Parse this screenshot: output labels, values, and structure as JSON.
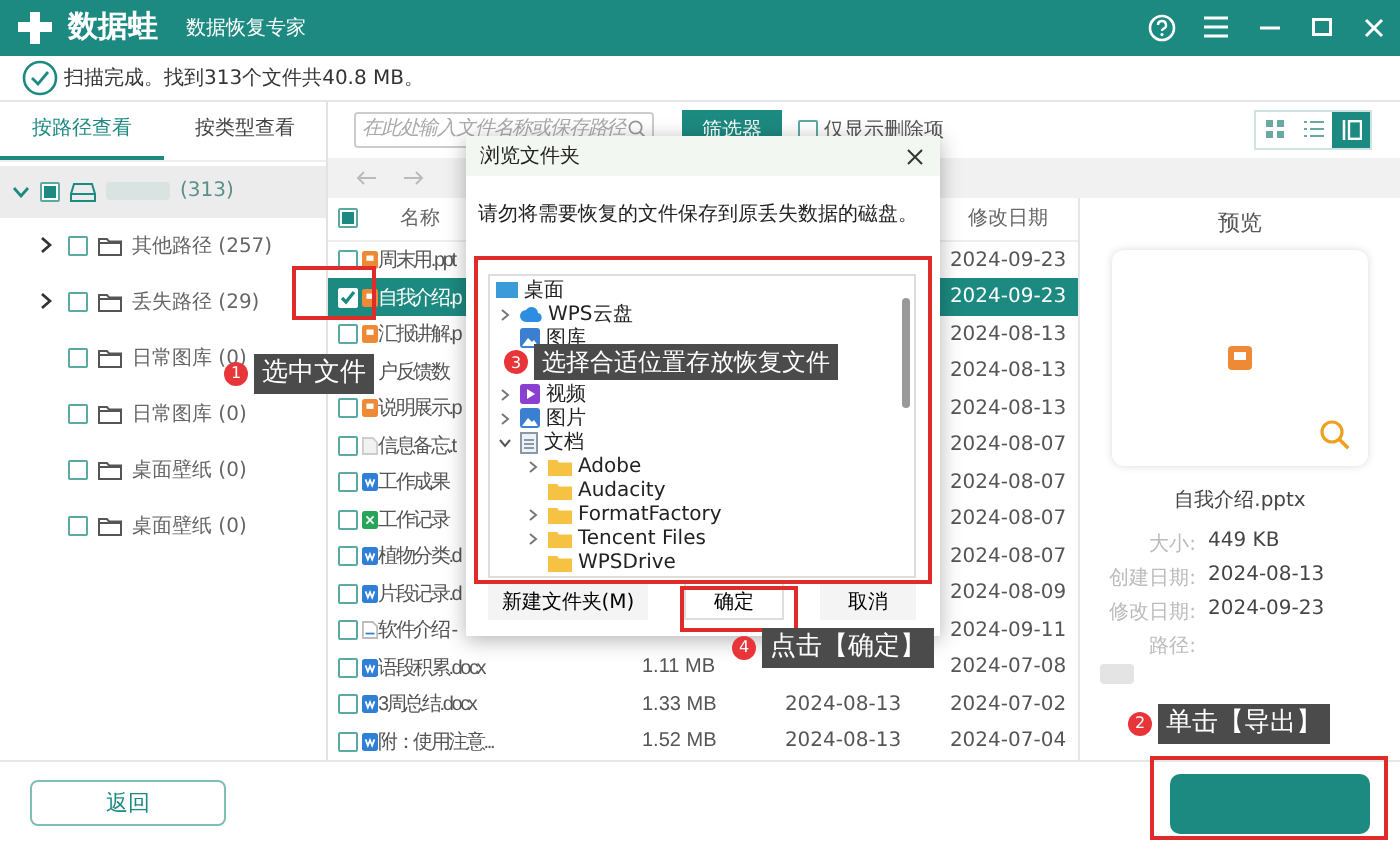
{
  "app": {
    "name": "数据蛙",
    "subtitle": "数据恢复专家"
  },
  "status": "扫描完成。找到313个文件共40.8 MB。",
  "view_tabs": [
    {
      "label": "按路径查看",
      "selected": true
    },
    {
      "label": "按类型查看",
      "selected": false
    }
  ],
  "tree": [
    {
      "label": "(313)",
      "selected": true,
      "checked": false,
      "partial": true,
      "expanded": true,
      "children": [
        {
          "label": "其他路径 (257)",
          "selected": false,
          "checked": false,
          "partial": false,
          "has_children": true,
          "expanded": false
        },
        {
          "label": "丢失路径 (29)",
          "selected": false,
          "checked": false,
          "partial": false,
          "has_children": true,
          "expanded": false
        },
        {
          "label": "日常图库 (0)",
          "selected": false,
          "checked": false,
          "partial": false,
          "has_children": false,
          "expanded": false
        },
        {
          "label": "日常图库 (0)",
          "selected": false,
          "checked": false,
          "partial": false,
          "has_children": false,
          "expanded": false
        },
        {
          "label": "桌面壁纸 (0)",
          "selected": false,
          "checked": false,
          "partial": false,
          "has_children": false,
          "expanded": false
        },
        {
          "label": "桌面壁纸 (0)",
          "selected": false,
          "checked": false,
          "partial": false,
          "has_children": false,
          "expanded": false
        }
      ]
    }
  ],
  "search": {
    "placeholder": "在此处输入文件名称或保存路径"
  },
  "filter_button": "筛选器",
  "deleted_only": {
    "label": "仅显示删除项",
    "checked": false
  },
  "view_modes": [
    {
      "kind": "grid",
      "selected": false
    },
    {
      "kind": "list",
      "selected": false
    },
    {
      "kind": "preview",
      "selected": true
    }
  ],
  "table": {
    "columns": [
      "名称",
      "修改日期"
    ],
    "header_checked": false,
    "header_partial": true,
    "rows": [
      {
        "name": "周末用.ppt",
        "kind": "ppt",
        "checked": false,
        "selected": false,
        "modified": "2024-09-23"
      },
      {
        "name": "自我介绍.p",
        "kind": "ppt",
        "checked": true,
        "selected": true,
        "modified": "2024-09-23"
      },
      {
        "name": "汇报讲解.p",
        "kind": "ppt",
        "checked": false,
        "selected": false,
        "modified": "2024-08-13"
      },
      {
        "name": "户反馈数",
        "selected": false,
        "modified": "2024-08-13"
      },
      {
        "name": "说明展示.p",
        "kind": "ppt",
        "checked": false,
        "selected": false,
        "modified": "2024-08-13"
      },
      {
        "name": "信息备忘.t",
        "kind": "txt",
        "checked": false,
        "selected": false,
        "modified": "2024-08-07"
      },
      {
        "name": "工作成果",
        "kind": "doc",
        "checked": false,
        "selected": false,
        "modified": "2024-08-07"
      },
      {
        "name": "工作记录",
        "kind": "xls",
        "checked": false,
        "selected": false,
        "modified": "2024-08-07"
      },
      {
        "name": "植物分类.d",
        "kind": "doc",
        "checked": false,
        "selected": false,
        "modified": "2024-08-07"
      },
      {
        "name": "片段记录.d",
        "kind": "doc",
        "checked": false,
        "selected": false,
        "modified": "2024-08-09"
      },
      {
        "name": "软件介绍 -",
        "kind": "file",
        "checked": false,
        "selected": false,
        "modified": "2024-09-11"
      },
      {
        "name": "语段积累.docx",
        "kind": "doc",
        "checked": false,
        "selected": false,
        "size": "1.11 MB",
        "modified": "2024-07-08"
      },
      {
        "name": "3周总结.docx",
        "kind": "doc",
        "checked": false,
        "selected": false,
        "size": "1.33 MB",
        "created": "2024-08-13",
        "modified": "2024-07-02"
      },
      {
        "name": "附：使用注意...",
        "kind": "doc",
        "checked": false,
        "selected": false,
        "size": "1.52 MB",
        "created": "2024-08-13",
        "modified": "2024-07-04"
      }
    ]
  },
  "preview": {
    "title": "预览",
    "file_name": "自我介绍.pptx",
    "fields": [
      {
        "label": "大小:",
        "value": "449 KB"
      },
      {
        "label": "创建日期:",
        "value": "2024-08-13"
      },
      {
        "label": "修改日期:",
        "value": "2024-09-23"
      },
      {
        "label": "路径:"
      }
    ]
  },
  "back_button": "返回",
  "dialog": {
    "title": "浏览文件夹",
    "message": "请勿将需要恢复的文件保存到原丢失数据的磁盘。",
    "tree": [
      {
        "label": "桌面",
        "kind": "desktop",
        "children": [
          {
            "label": "WPS云盘",
            "kind": "cloud",
            "has_children": true,
            "expanded": false
          },
          {
            "label": "图库",
            "kind": "gallery",
            "has_children": false,
            "expanded": false
          },
          {
            "label": "视频",
            "kind": "video",
            "has_children": true,
            "expanded": false
          },
          {
            "label": "图片",
            "kind": "picture",
            "has_children": true,
            "expanded": false
          },
          {
            "label": "文档",
            "kind": "docs",
            "has_children": true,
            "expanded": true,
            "children": [
              {
                "label": "Adobe",
                "kind": "folder",
                "has_children": true,
                "expanded": false
              },
              {
                "label": "Audacity",
                "kind": "folder",
                "has_children": false,
                "expanded": false
              },
              {
                "label": "FormatFactory",
                "kind": "folder",
                "has_children": true,
                "expanded": false
              },
              {
                "label": "Tencent Files",
                "kind": "folder",
                "has_children": true,
                "expanded": false
              },
              {
                "label": "WPSDrive",
                "kind": "folder",
                "has_children": false,
                "expanded": false
              }
            ]
          }
        ]
      }
    ],
    "buttons": [
      {
        "label": "新建文件夹(M)",
        "highlighted": false
      },
      {
        "label": "确定",
        "highlighted": true
      },
      {
        "label": "取消",
        "highlighted": false
      }
    ]
  },
  "callouts": [
    {
      "number": "1",
      "text": "选中文件"
    },
    {
      "number": "2",
      "text": "单击【导出】"
    },
    {
      "number": "3",
      "text": "选择合适位置存放恢复文件"
    },
    {
      "number": "4",
      "text": "点击【确定】"
    }
  ]
}
